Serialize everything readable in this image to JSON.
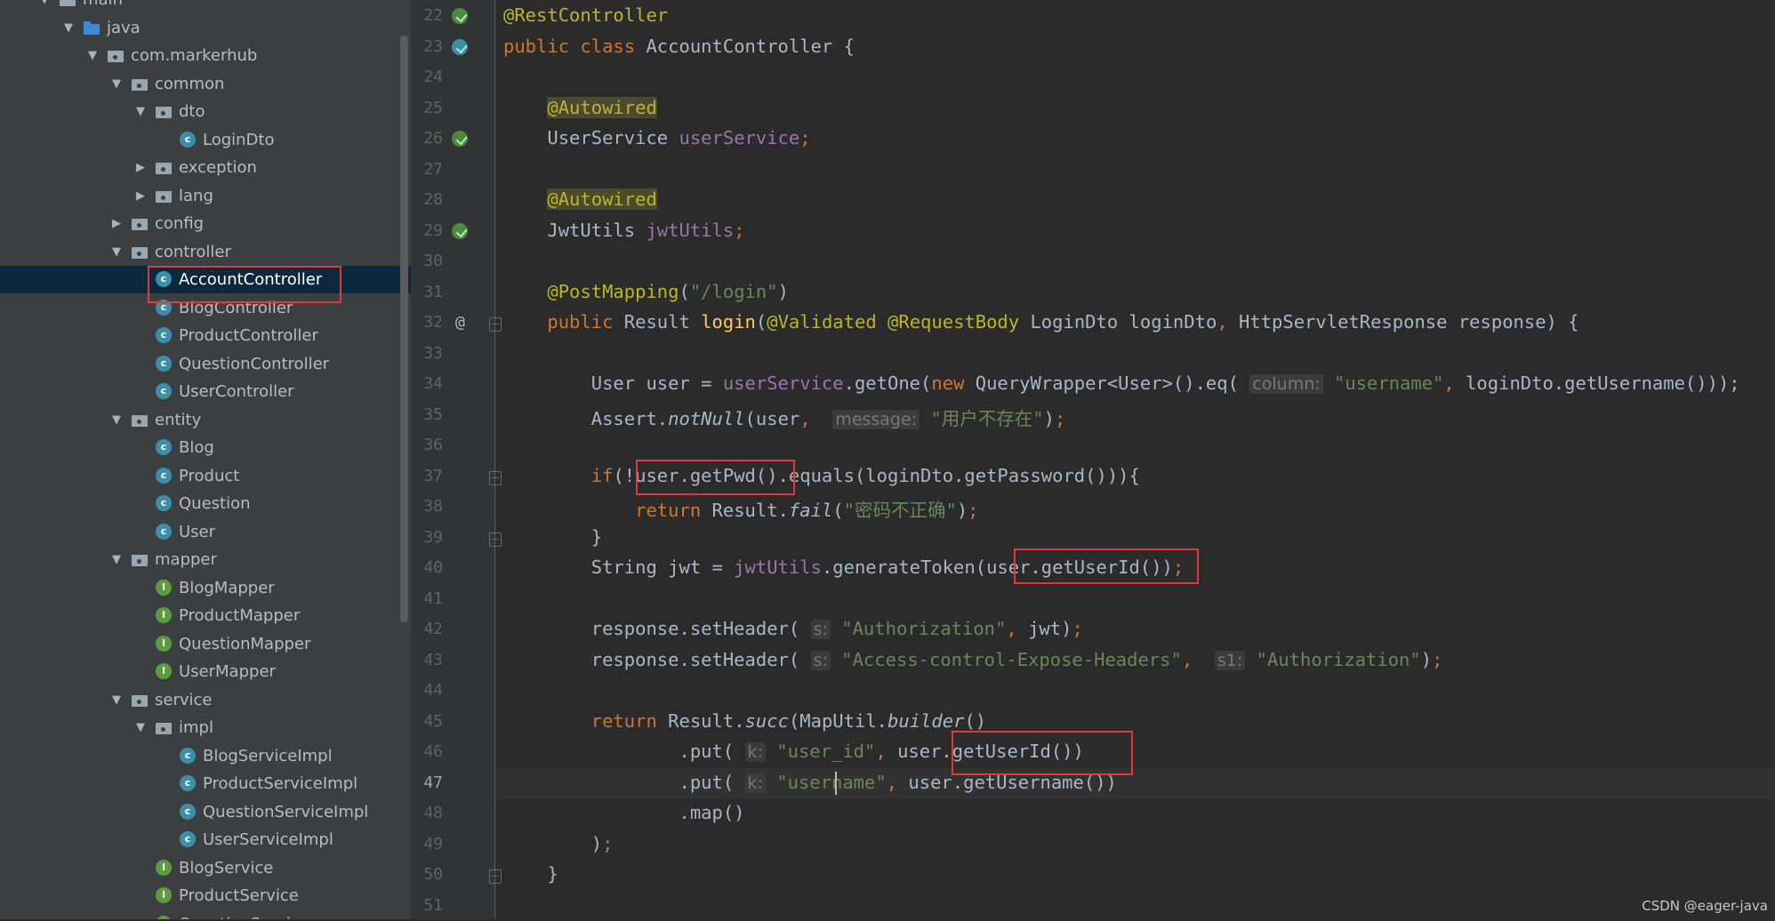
{
  "project_tree": [
    {
      "label": "main",
      "icon": "folder",
      "depth": 0,
      "arrow": "expanded"
    },
    {
      "label": "java",
      "icon": "folder-source",
      "depth": 1,
      "arrow": "expanded"
    },
    {
      "label": "com.markerhub",
      "icon": "package",
      "depth": 2,
      "arrow": "expanded"
    },
    {
      "label": "common",
      "icon": "package",
      "depth": 3,
      "arrow": "expanded"
    },
    {
      "label": "dto",
      "icon": "package",
      "depth": 4,
      "arrow": "expanded"
    },
    {
      "label": "LoginDto",
      "icon": "class",
      "depth": 5,
      "arrow": "none"
    },
    {
      "label": "exception",
      "icon": "package",
      "depth": 4,
      "arrow": "collapsed"
    },
    {
      "label": "lang",
      "icon": "package",
      "depth": 4,
      "arrow": "collapsed"
    },
    {
      "label": "config",
      "icon": "package",
      "depth": 3,
      "arrow": "collapsed"
    },
    {
      "label": "controller",
      "icon": "package",
      "depth": 3,
      "arrow": "expanded"
    },
    {
      "label": "AccountController",
      "icon": "class",
      "depth": 4,
      "arrow": "none",
      "selected": true
    },
    {
      "label": "BlogController",
      "icon": "class",
      "depth": 4,
      "arrow": "none"
    },
    {
      "label": "ProductController",
      "icon": "class",
      "depth": 4,
      "arrow": "none"
    },
    {
      "label": "QuestionController",
      "icon": "class",
      "depth": 4,
      "arrow": "none"
    },
    {
      "label": "UserController",
      "icon": "class",
      "depth": 4,
      "arrow": "none"
    },
    {
      "label": "entity",
      "icon": "package",
      "depth": 3,
      "arrow": "expanded"
    },
    {
      "label": "Blog",
      "icon": "class",
      "depth": 4,
      "arrow": "none"
    },
    {
      "label": "Product",
      "icon": "class",
      "depth": 4,
      "arrow": "none"
    },
    {
      "label": "Question",
      "icon": "class",
      "depth": 4,
      "arrow": "none"
    },
    {
      "label": "User",
      "icon": "class",
      "depth": 4,
      "arrow": "none"
    },
    {
      "label": "mapper",
      "icon": "package",
      "depth": 3,
      "arrow": "expanded"
    },
    {
      "label": "BlogMapper",
      "icon": "interface",
      "depth": 4,
      "arrow": "none"
    },
    {
      "label": "ProductMapper",
      "icon": "interface",
      "depth": 4,
      "arrow": "none"
    },
    {
      "label": "QuestionMapper",
      "icon": "interface",
      "depth": 4,
      "arrow": "none"
    },
    {
      "label": "UserMapper",
      "icon": "interface",
      "depth": 4,
      "arrow": "none"
    },
    {
      "label": "service",
      "icon": "package",
      "depth": 3,
      "arrow": "expanded"
    },
    {
      "label": "impl",
      "icon": "package",
      "depth": 4,
      "arrow": "expanded"
    },
    {
      "label": "BlogServiceImpl",
      "icon": "class",
      "depth": 5,
      "arrow": "none"
    },
    {
      "label": "ProductServiceImpl",
      "icon": "class",
      "depth": 5,
      "arrow": "none"
    },
    {
      "label": "QuestionServiceImpl",
      "icon": "class",
      "depth": 5,
      "arrow": "none"
    },
    {
      "label": "UserServiceImpl",
      "icon": "class",
      "depth": 5,
      "arrow": "none"
    },
    {
      "label": "BlogService",
      "icon": "interface",
      "depth": 4,
      "arrow": "none"
    },
    {
      "label": "ProductService",
      "icon": "interface",
      "depth": 4,
      "arrow": "none"
    },
    {
      "label": "QuestionService",
      "icon": "interface",
      "depth": 4,
      "arrow": "none"
    }
  ],
  "editor": {
    "current_line": 47,
    "colors": {
      "keyword": "#cc7832",
      "annotation": "#bbb529",
      "string": "#6a8759",
      "field": "#9876aa",
      "method": "#ffc66d",
      "default": "#a9b7c6",
      "hint": "#787878"
    },
    "lines": [
      {
        "n": 22,
        "tokens": [
          {
            "t": "@RestController",
            "c": "annotation"
          }
        ]
      },
      {
        "n": 23,
        "tokens": [
          {
            "t": "public class ",
            "c": "keyword"
          },
          {
            "t": "AccountController {"
          }
        ]
      },
      {
        "n": 24,
        "tokens": []
      },
      {
        "n": 25,
        "tokens": [
          {
            "t": "    "
          },
          {
            "t": "@Autowired",
            "c": "annotation",
            "bg": "#4b4a31"
          }
        ]
      },
      {
        "n": 26,
        "tokens": [
          {
            "t": "    UserService "
          },
          {
            "t": "userService",
            "c": "field"
          },
          {
            "t": ";",
            "c": "keyword"
          }
        ]
      },
      {
        "n": 27,
        "tokens": []
      },
      {
        "n": 28,
        "tokens": [
          {
            "t": "    "
          },
          {
            "t": "@Autowired",
            "c": "annotation",
            "bg": "#4b4a31"
          }
        ]
      },
      {
        "n": 29,
        "tokens": [
          {
            "t": "    JwtUtils "
          },
          {
            "t": "jwtUtils",
            "c": "field"
          },
          {
            "t": ";",
            "c": "keyword"
          }
        ]
      },
      {
        "n": 30,
        "tokens": []
      },
      {
        "n": 31,
        "tokens": [
          {
            "t": "    "
          },
          {
            "t": "@PostMapping",
            "c": "annotation"
          },
          {
            "t": "("
          },
          {
            "t": "\"/login\"",
            "c": "string"
          },
          {
            "t": ")"
          }
        ]
      },
      {
        "n": 32,
        "tokens": [
          {
            "t": "    "
          },
          {
            "t": "public ",
            "c": "keyword"
          },
          {
            "t": "Result "
          },
          {
            "t": "login",
            "c": "method"
          },
          {
            "t": "("
          },
          {
            "t": "@Validated @RequestBody ",
            "c": "annotation"
          },
          {
            "t": "LoginDto loginDto"
          },
          {
            "t": ", ",
            "c": "keyword"
          },
          {
            "t": "HttpServletResponse response) {"
          }
        ]
      },
      {
        "n": 33,
        "tokens": []
      },
      {
        "n": 34,
        "tokens": [
          {
            "t": "        User user = "
          },
          {
            "t": "userService",
            "c": "field"
          },
          {
            "t": ".getOne("
          },
          {
            "t": "new ",
            "c": "keyword"
          },
          {
            "t": "QueryWrapper<User>().eq( "
          },
          {
            "t": "column:",
            "c": "hint"
          },
          {
            "t": " "
          },
          {
            "t": "\"username\"",
            "c": "string"
          },
          {
            "t": ", ",
            "c": "keyword"
          },
          {
            "t": "loginDto.getUsername()));"
          }
        ]
      },
      {
        "n": 35,
        "tokens": [
          {
            "t": "        Assert."
          },
          {
            "t": "notNull",
            "i": true
          },
          {
            "t": "(user"
          },
          {
            "t": ", ",
            "c": "keyword"
          },
          {
            "t": " "
          },
          {
            "t": "message:",
            "c": "hint"
          },
          {
            "t": " "
          },
          {
            "t": "\"用户不存在\"",
            "c": "string"
          },
          {
            "t": ")"
          },
          {
            "t": ";",
            "c": "keyword"
          }
        ]
      },
      {
        "n": 36,
        "tokens": []
      },
      {
        "n": 37,
        "tokens": [
          {
            "t": "        "
          },
          {
            "t": "if",
            "c": "keyword"
          },
          {
            "t": "(!user.getPwd().equals(loginDto.getPassword())){"
          }
        ]
      },
      {
        "n": 38,
        "tokens": [
          {
            "t": "            "
          },
          {
            "t": "return ",
            "c": "keyword"
          },
          {
            "t": "Result."
          },
          {
            "t": "fail",
            "i": true
          },
          {
            "t": "("
          },
          {
            "t": "\"密码不正确\"",
            "c": "string"
          },
          {
            "t": ")"
          },
          {
            "t": ";",
            "c": "keyword"
          }
        ]
      },
      {
        "n": 39,
        "tokens": [
          {
            "t": "        }"
          }
        ]
      },
      {
        "n": 40,
        "tokens": [
          {
            "t": "        String jwt = "
          },
          {
            "t": "jwtUtils",
            "c": "field"
          },
          {
            "t": ".generateToken(user.getUserId())"
          },
          {
            "t": ";",
            "c": "keyword"
          }
        ]
      },
      {
        "n": 41,
        "tokens": []
      },
      {
        "n": 42,
        "tokens": [
          {
            "t": "        response.setHeader( "
          },
          {
            "t": "s:",
            "c": "hint"
          },
          {
            "t": " "
          },
          {
            "t": "\"Authorization\"",
            "c": "string"
          },
          {
            "t": ", ",
            "c": "keyword"
          },
          {
            "t": "jwt)"
          },
          {
            "t": ";",
            "c": "keyword"
          }
        ]
      },
      {
        "n": 43,
        "tokens": [
          {
            "t": "        response.setHeader( "
          },
          {
            "t": "s:",
            "c": "hint"
          },
          {
            "t": " "
          },
          {
            "t": "\"Access-control-Expose-Headers\"",
            "c": "string"
          },
          {
            "t": ", ",
            "c": "keyword"
          },
          {
            "t": " "
          },
          {
            "t": "s1:",
            "c": "hint"
          },
          {
            "t": " "
          },
          {
            "t": "\"Authorization\"",
            "c": "string"
          },
          {
            "t": ")"
          },
          {
            "t": ";",
            "c": "keyword"
          }
        ]
      },
      {
        "n": 44,
        "tokens": []
      },
      {
        "n": 45,
        "tokens": [
          {
            "t": "        "
          },
          {
            "t": "return ",
            "c": "keyword"
          },
          {
            "t": "Result."
          },
          {
            "t": "succ",
            "i": true
          },
          {
            "t": "(MapUtil."
          },
          {
            "t": "builder",
            "i": true
          },
          {
            "t": "()"
          }
        ]
      },
      {
        "n": 46,
        "tokens": [
          {
            "t": "                .put( "
          },
          {
            "t": "k:",
            "c": "hint"
          },
          {
            "t": " "
          },
          {
            "t": "\"user_id\"",
            "c": "string"
          },
          {
            "t": ", ",
            "c": "keyword"
          },
          {
            "t": "user.getUserId())"
          }
        ]
      },
      {
        "n": 47,
        "tokens": [
          {
            "t": "                .put( "
          },
          {
            "t": "k:",
            "c": "hint"
          },
          {
            "t": " "
          },
          {
            "t": "\"username\"",
            "c": "string"
          },
          {
            "t": ", ",
            "c": "keyword"
          },
          {
            "t": "user.getUsername())"
          }
        ]
      },
      {
        "n": 48,
        "tokens": [
          {
            "t": "                .map()"
          }
        ]
      },
      {
        "n": 49,
        "tokens": [
          {
            "t": "        )"
          },
          {
            "t": ";",
            "c": "keyword"
          }
        ]
      },
      {
        "n": 50,
        "tokens": [
          {
            "t": "    }"
          }
        ]
      },
      {
        "n": 51,
        "tokens": []
      }
    ]
  },
  "gutter_icons": [
    {
      "line": 22,
      "icon": "spring-bean-icon"
    },
    {
      "line": 23,
      "icon": "spring-class-icon"
    },
    {
      "line": 26,
      "icon": "autowired-bean-icon"
    },
    {
      "line": 29,
      "icon": "autowired-bean-icon"
    },
    {
      "line": 32,
      "icon": "at-mapping-icon",
      "glyph": "@"
    }
  ],
  "watermark": "CSDN @eager-java"
}
